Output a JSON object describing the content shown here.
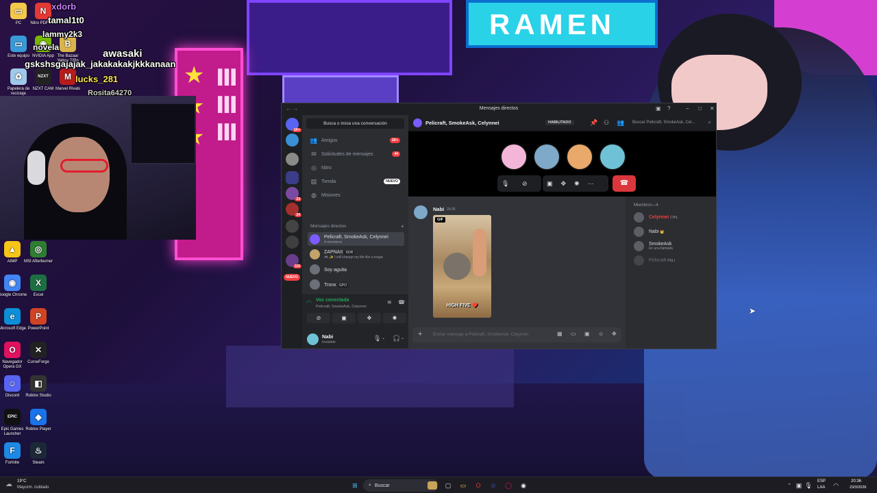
{
  "desktop": {
    "icons_top": [
      {
        "label": "PC",
        "color": "#f3c94a",
        "glyph": "▭"
      },
      {
        "label": "Nitro PDF Pro",
        "color": "#e53935",
        "glyph": "N"
      },
      {
        "label": "Este equipo",
        "color": "#3a9ad9",
        "glyph": "▭"
      },
      {
        "label": "NVIDIA App",
        "color": "#76b900",
        "glyph": "◉"
      },
      {
        "label": "The Bazaar Yellow Tiffin",
        "color": "#d9b44a",
        "glyph": "B"
      },
      {
        "label": "Papelera de reciclaje",
        "color": "#9fc8ea",
        "glyph": "♻"
      },
      {
        "label": "NZXT CAM",
        "color": "#222",
        "glyph": "NZXT"
      },
      {
        "label": "Marvel Rivals",
        "color": "#b71c1c",
        "glyph": "M"
      }
    ],
    "icons_left": [
      {
        "label": "AIMP",
        "color": "#f5c518",
        "glyph": "▲"
      },
      {
        "label": "MSI Afterburner",
        "color": "#2e7d32",
        "glyph": "◎"
      },
      {
        "label": "Google Chrome",
        "color": "#4285f4",
        "glyph": "◉"
      },
      {
        "label": "Excel",
        "color": "#1d6f42",
        "glyph": "X"
      },
      {
        "label": "Microsoft Edge",
        "color": "#0c8fd8",
        "glyph": "e"
      },
      {
        "label": "PowerPoint",
        "color": "#d04423",
        "glyph": "P"
      },
      {
        "label": "Navegador Opera GX",
        "color": "#e0115f",
        "glyph": "O"
      },
      {
        "label": "CurseForge",
        "color": "#222",
        "glyph": "✕"
      },
      {
        "label": "Discord",
        "color": "#5865f2",
        "glyph": "☺"
      },
      {
        "label": "Roblox Studio",
        "color": "#333",
        "glyph": "◧"
      },
      {
        "label": "Epic Games Launcher",
        "color": "#111",
        "glyph": "EPIC"
      },
      {
        "label": "Roblox Player",
        "color": "#1a73e8",
        "glyph": "◆"
      },
      {
        "label": "Fortnite",
        "color": "#1e88e5",
        "glyph": "F"
      },
      {
        "label": "Steam",
        "color": "#1b2838",
        "glyph": "♨"
      }
    ]
  },
  "stream_chat": [
    {
      "text": "xdorb",
      "color": "#c77dff"
    },
    {
      "text": "tamal1t0",
      "color": "#ffffff"
    },
    {
      "text": "lammy2k3",
      "color": "#ffffff"
    },
    {
      "text": "novela",
      "color": "#ffffff"
    },
    {
      "text": "awasaki",
      "color": "#ffffff"
    },
    {
      "text": "gskshsgajajak_jakakakakjkkkanaan",
      "color": "#ffffff"
    },
    {
      "text": "lucks_281",
      "color": "#ffe259"
    },
    {
      "text": "Rosita64270",
      "color": "#cfcfcf"
    }
  ],
  "discord": {
    "window_title": "Mensajes directos",
    "server_badges": [
      "1K+",
      "23",
      "24",
      "116",
      "NUEVO"
    ],
    "search_button": "Busca o inicia una conversación",
    "nav": [
      {
        "label": "Amigos",
        "icon": "friends-icon",
        "glyph": "👥",
        "badge": "1K+"
      },
      {
        "label": "Solicitudes de mensajes",
        "icon": "mail-icon",
        "glyph": "✉",
        "badge": "44"
      },
      {
        "label": "Nitro",
        "icon": "nitro-icon",
        "glyph": "◎",
        "badge": ""
      },
      {
        "label": "Tienda",
        "icon": "shop-icon",
        "glyph": "▤",
        "badge": "NUEVO"
      },
      {
        "label": "Misiones",
        "icon": "quests-icon",
        "glyph": "◍",
        "badge": ""
      }
    ],
    "dm_header": "Mensajes directos",
    "dm_add": "+",
    "dms": [
      {
        "name": "Pelicraft, SmokeAsk, Celynnei",
        "sub": "4 miembros",
        "tag": "",
        "color": "#7a5cff",
        "active": true
      },
      {
        "name": "ZAPNAII",
        "sub": "🎮 ✨ I will change my life like a magic",
        "tag": "SOR",
        "color": "#c2a36b",
        "active": false
      },
      {
        "name": "Soy aguita",
        "sub": "",
        "tag": "",
        "color": "#6d6f78",
        "active": false
      },
      {
        "name": "Tronx",
        "sub": "",
        "tag": "GPO",
        "color": "#6d6f78",
        "active": false
      },
      {
        "name": "Herii",
        "sub": "",
        "tag": "",
        "color": "#8b5a9a",
        "active": false
      }
    ],
    "voice": {
      "status": "Voz conectada",
      "channel": "Pelicraft, SmokeAsk, Celynnei"
    },
    "user": {
      "name": "Nabi",
      "status": "Invisible"
    },
    "channel": {
      "name": "Pelicraft, SmokeAsk, Celynnei",
      "badge": "HABILITADO",
      "search_placeholder": "Buscar Pelicraft, SmokeAsk, Cel..."
    },
    "call_avatars": [
      {
        "name": "pelicraft-avatar",
        "color": "#f3b6d8"
      },
      {
        "name": "smokeask-avatar",
        "color": "#7fa9c9"
      },
      {
        "name": "celynnei-avatar",
        "color": "#e8a96a"
      },
      {
        "name": "nabi-avatar",
        "color": "#6fc2d6"
      }
    ],
    "message": {
      "author": "Nabi",
      "time": "20:35",
      "gif_label": "GIF",
      "gif_caption": "HIGH FIVE ❤️"
    },
    "composer_placeholder": "Enviar mensaje a Pelicraft, SmokeAsk, Celynnei",
    "members_header": "Miembros—4",
    "members": [
      {
        "name": "Celynnei",
        "tag": "CHIL",
        "color": "#f23f43",
        "sub": ""
      },
      {
        "name": "Nabi",
        "tag": "👑",
        "color": "#dbdee1",
        "sub": ""
      },
      {
        "name": "SmokeAsk",
        "tag": "",
        "color": "#dbdee1",
        "sub": "En una llamada"
      },
      {
        "name": "Pelicraft",
        "tag": "PELI",
        "color": "#6d6f78",
        "sub": ""
      }
    ]
  },
  "taskbar": {
    "weather_temp": "19°C",
    "weather_desc": "Mayorm. nublado",
    "search": "Buscar",
    "lang": "ESP",
    "lang2": "LAA",
    "time": "20:36",
    "date": "23/3/2026"
  }
}
